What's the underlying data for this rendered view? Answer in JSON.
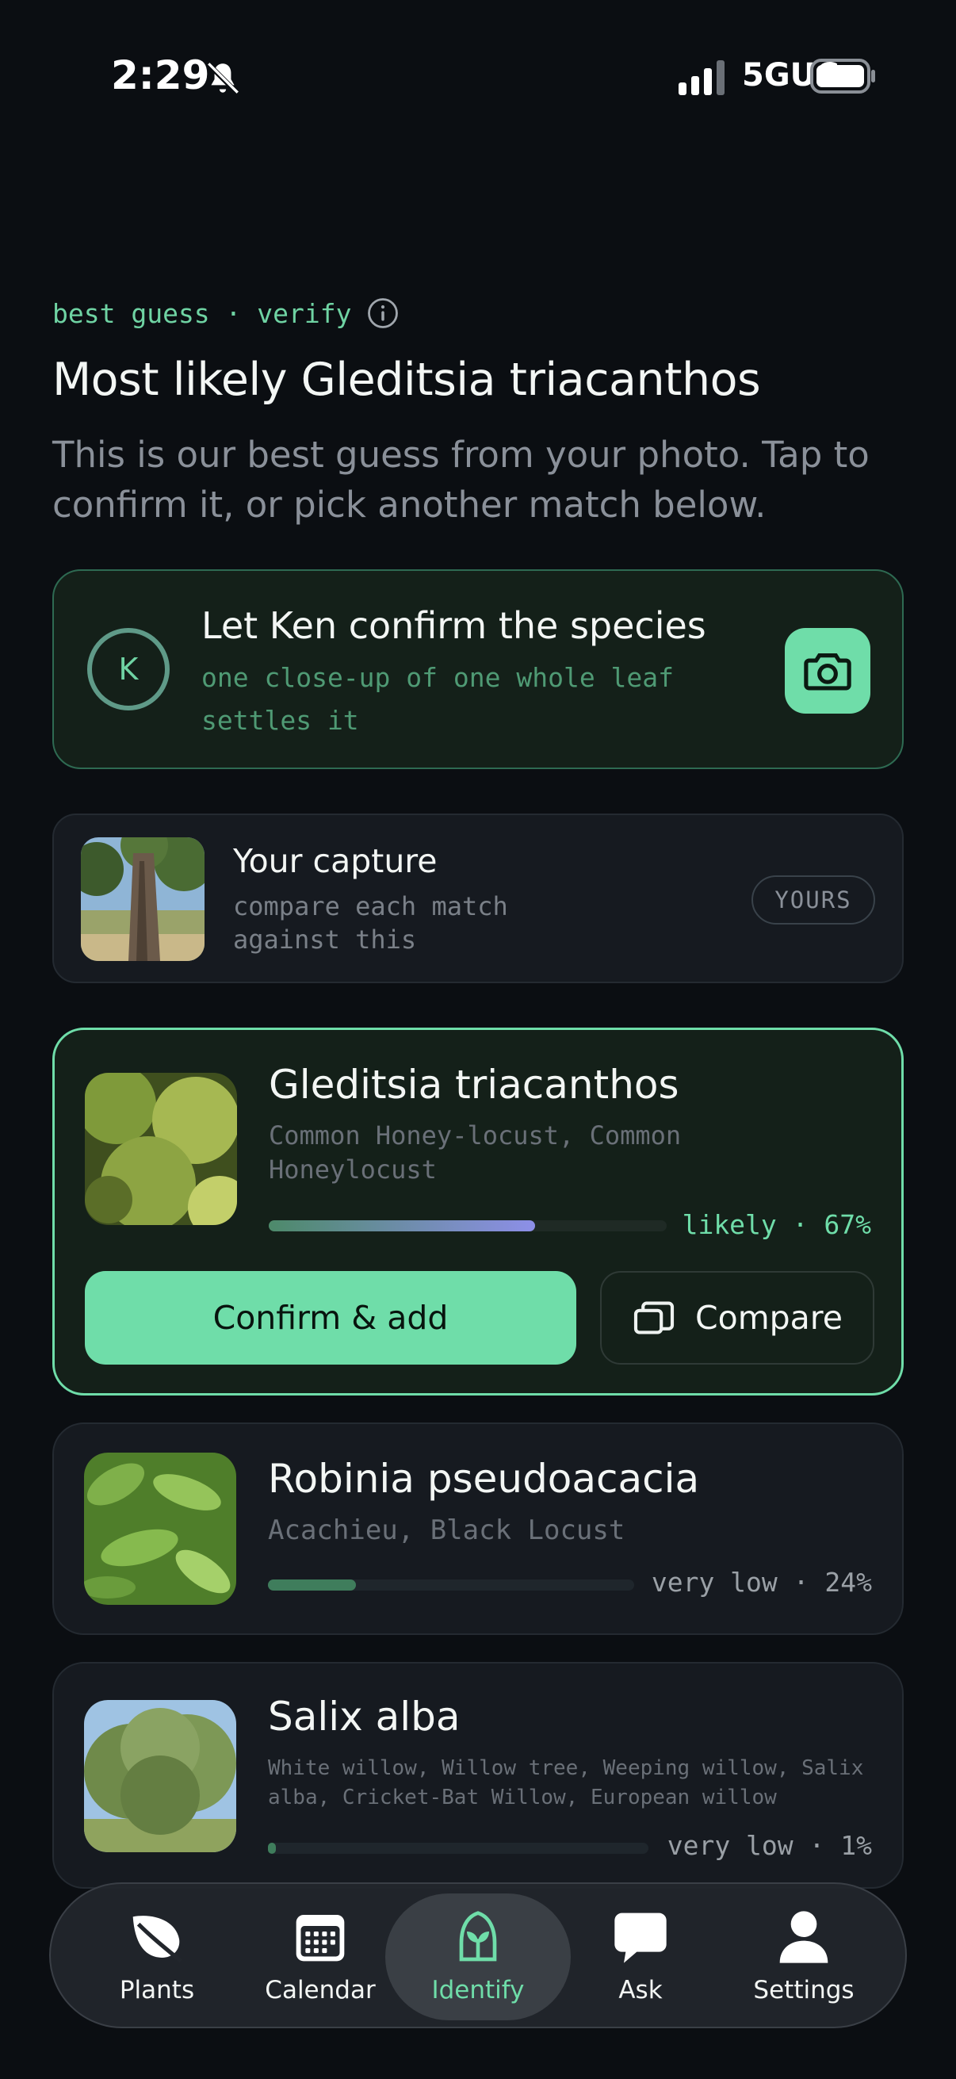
{
  "status_bar": {
    "time": "2:29",
    "network": "5GUC"
  },
  "header": {
    "eyebrow": "best guess · verify",
    "title": "Most likely Gleditsia triacanthos",
    "subtitle": "This is our best guess from your photo. Tap to confirm it, or pick another match below."
  },
  "ken": {
    "avatar_letter": "K",
    "title": "Let Ken confirm the species",
    "subtitle": "one close-up of one whole leaf settles it"
  },
  "capture": {
    "title": "Your capture",
    "subtitle": "compare each match against this",
    "badge": "YOURS"
  },
  "matches": [
    {
      "name": "Gleditsia triacanthos",
      "common": "Common Honey-locust, Common Honeylocust",
      "level": "likely · 67%",
      "confidence": 0.67,
      "confirm_label": "Confirm & add",
      "compare_label": "Compare"
    },
    {
      "name": "Robinia pseudoacacia",
      "common": "Acachieu, Black Locust",
      "level": "very low · 24%",
      "confidence": 0.24
    },
    {
      "name": "Salix alba",
      "common": "White willow, Willow tree, Weeping willow, Salix alba, Cricket-Bat Willow, European willow",
      "level": "very low · 1%",
      "confidence": 0.01
    }
  ],
  "nav": {
    "items": [
      {
        "label": "Plants",
        "icon": "leaf-icon"
      },
      {
        "label": "Calendar",
        "icon": "calendar-icon"
      },
      {
        "label": "Identify",
        "icon": "identify-icon"
      },
      {
        "label": "Ask",
        "icon": "chat-icon"
      },
      {
        "label": "Settings",
        "icon": "person-icon"
      }
    ],
    "active": "Identify"
  },
  "colors": {
    "accent": "#6fdda9",
    "background": "#0b0e12",
    "card": "#161a20",
    "highlight_card": "#142019"
  }
}
